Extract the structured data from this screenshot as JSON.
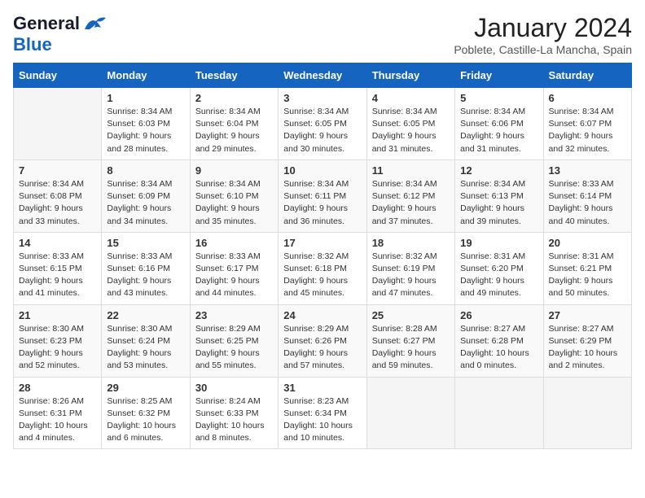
{
  "header": {
    "logo_general": "General",
    "logo_blue": "Blue",
    "month_title": "January 2024",
    "location": "Poblete, Castille-La Mancha, Spain"
  },
  "days_of_week": [
    "Sunday",
    "Monday",
    "Tuesday",
    "Wednesday",
    "Thursday",
    "Friday",
    "Saturday"
  ],
  "weeks": [
    [
      {
        "day": "",
        "data": ""
      },
      {
        "day": "1",
        "data": "Sunrise: 8:34 AM\nSunset: 6:03 PM\nDaylight: 9 hours\nand 28 minutes."
      },
      {
        "day": "2",
        "data": "Sunrise: 8:34 AM\nSunset: 6:04 PM\nDaylight: 9 hours\nand 29 minutes."
      },
      {
        "day": "3",
        "data": "Sunrise: 8:34 AM\nSunset: 6:05 PM\nDaylight: 9 hours\nand 30 minutes."
      },
      {
        "day": "4",
        "data": "Sunrise: 8:34 AM\nSunset: 6:05 PM\nDaylight: 9 hours\nand 31 minutes."
      },
      {
        "day": "5",
        "data": "Sunrise: 8:34 AM\nSunset: 6:06 PM\nDaylight: 9 hours\nand 31 minutes."
      },
      {
        "day": "6",
        "data": "Sunrise: 8:34 AM\nSunset: 6:07 PM\nDaylight: 9 hours\nand 32 minutes."
      }
    ],
    [
      {
        "day": "7",
        "data": ""
      },
      {
        "day": "8",
        "data": "Sunrise: 8:34 AM\nSunset: 6:09 PM\nDaylight: 9 hours\nand 34 minutes."
      },
      {
        "day": "9",
        "data": "Sunrise: 8:34 AM\nSunset: 6:10 PM\nDaylight: 9 hours\nand 35 minutes."
      },
      {
        "day": "10",
        "data": "Sunrise: 8:34 AM\nSunset: 6:11 PM\nDaylight: 9 hours\nand 36 minutes."
      },
      {
        "day": "11",
        "data": "Sunrise: 8:34 AM\nSunset: 6:12 PM\nDaylight: 9 hours\nand 37 minutes."
      },
      {
        "day": "12",
        "data": "Sunrise: 8:34 AM\nSunset: 6:13 PM\nDaylight: 9 hours\nand 39 minutes."
      },
      {
        "day": "13",
        "data": "Sunrise: 8:33 AM\nSunset: 6:14 PM\nDaylight: 9 hours\nand 40 minutes."
      }
    ],
    [
      {
        "day": "14",
        "data": ""
      },
      {
        "day": "15",
        "data": "Sunrise: 8:33 AM\nSunset: 6:16 PM\nDaylight: 9 hours\nand 43 minutes."
      },
      {
        "day": "16",
        "data": "Sunrise: 8:33 AM\nSunset: 6:17 PM\nDaylight: 9 hours\nand 44 minutes."
      },
      {
        "day": "17",
        "data": "Sunrise: 8:32 AM\nSunset: 6:18 PM\nDaylight: 9 hours\nand 45 minutes."
      },
      {
        "day": "18",
        "data": "Sunrise: 8:32 AM\nSunset: 6:19 PM\nDaylight: 9 hours\nand 47 minutes."
      },
      {
        "day": "19",
        "data": "Sunrise: 8:31 AM\nSunset: 6:20 PM\nDaylight: 9 hours\nand 49 minutes."
      },
      {
        "day": "20",
        "data": "Sunrise: 8:31 AM\nSunset: 6:21 PM\nDaylight: 9 hours\nand 50 minutes."
      }
    ],
    [
      {
        "day": "21",
        "data": ""
      },
      {
        "day": "22",
        "data": "Sunrise: 8:30 AM\nSunset: 6:24 PM\nDaylight: 9 hours\nand 53 minutes."
      },
      {
        "day": "23",
        "data": "Sunrise: 8:29 AM\nSunset: 6:25 PM\nDaylight: 9 hours\nand 55 minutes."
      },
      {
        "day": "24",
        "data": "Sunrise: 8:29 AM\nSunset: 6:26 PM\nDaylight: 9 hours\nand 57 minutes."
      },
      {
        "day": "25",
        "data": "Sunrise: 8:28 AM\nSunset: 6:27 PM\nDaylight: 9 hours\nand 59 minutes."
      },
      {
        "day": "26",
        "data": "Sunrise: 8:27 AM\nSunset: 6:28 PM\nDaylight: 10 hours\nand 0 minutes."
      },
      {
        "day": "27",
        "data": "Sunrise: 8:27 AM\nSunset: 6:29 PM\nDaylight: 10 hours\nand 2 minutes."
      }
    ],
    [
      {
        "day": "28",
        "data": ""
      },
      {
        "day": "29",
        "data": "Sunrise: 8:25 AM\nSunset: 6:32 PM\nDaylight: 10 hours\nand 6 minutes."
      },
      {
        "day": "30",
        "data": "Sunrise: 8:24 AM\nSunset: 6:33 PM\nDaylight: 10 hours\nand 8 minutes."
      },
      {
        "day": "31",
        "data": "Sunrise: 8:23 AM\nSunset: 6:34 PM\nDaylight: 10 hours\nand 10 minutes."
      },
      {
        "day": "",
        "data": ""
      },
      {
        "day": "",
        "data": ""
      },
      {
        "day": "",
        "data": ""
      }
    ]
  ],
  "week1_day7_data": "Sunrise: 8:34 AM\nSunset: 6:08 PM\nDaylight: 9 hours\nand 33 minutes.",
  "week2_day1_data": "Sunrise: 8:34 AM\nSunset: 6:08 PM\nDaylight: 9 hours\nand 33 minutes.",
  "week3_day1_data": "Sunrise: 8:33 AM\nSunset: 6:15 PM\nDaylight: 9 hours\nand 41 minutes.",
  "week4_day1_data": "Sunrise: 8:30 AM\nSunset: 6:23 PM\nDaylight: 9 hours\nand 52 minutes.",
  "week5_day1_data": "Sunrise: 8:26 AM\nSunset: 6:31 PM\nDaylight: 10 hours\nand 4 minutes."
}
